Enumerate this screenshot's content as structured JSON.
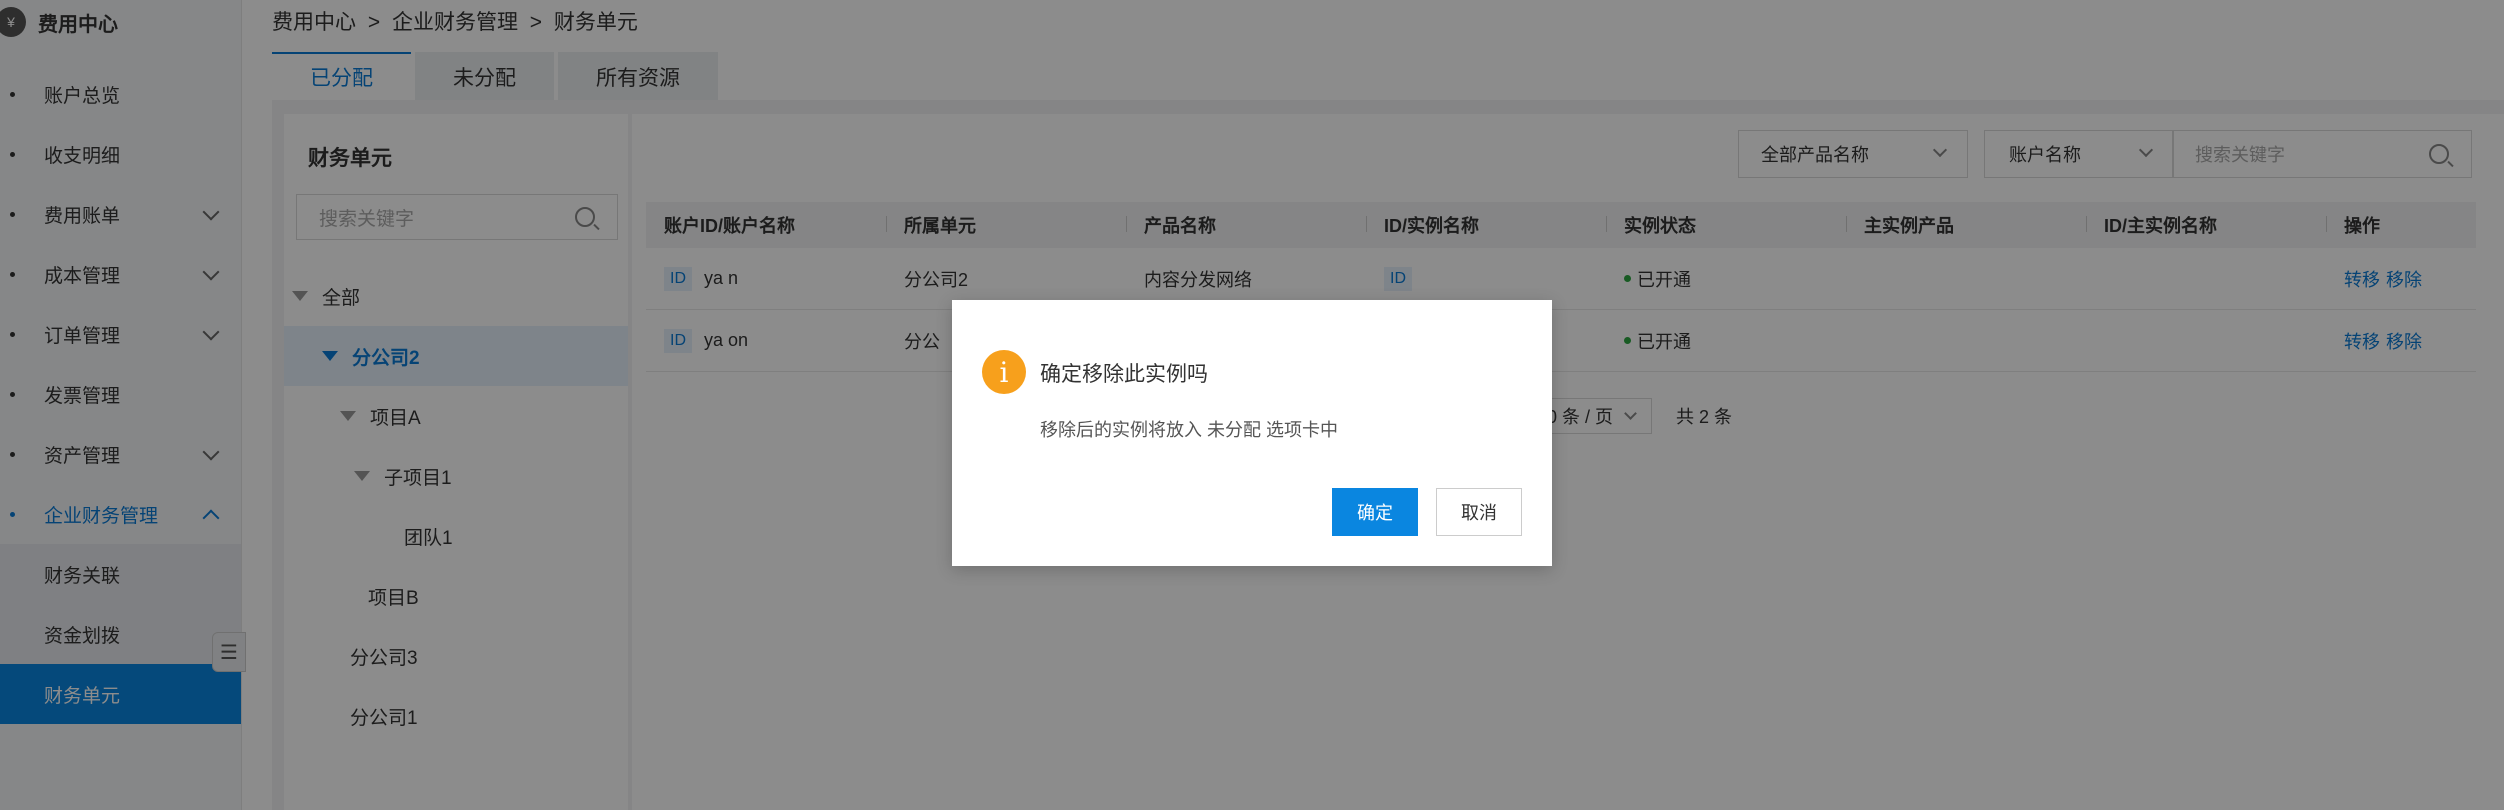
{
  "sidebar": {
    "title": "费用中心",
    "items": [
      {
        "label": "账户总览"
      },
      {
        "label": "收支明细"
      },
      {
        "label": "费用账单"
      },
      {
        "label": "成本管理"
      },
      {
        "label": "订单管理"
      },
      {
        "label": "发票管理"
      },
      {
        "label": "资产管理"
      },
      {
        "label": "企业财务管理"
      }
    ],
    "sub_items": [
      {
        "label": "财务关联"
      },
      {
        "label": "资金划拨"
      },
      {
        "label": "财务单元"
      }
    ]
  },
  "breadcrumb": {
    "a": "费用中心",
    "sep1": ">",
    "b": "企业财务管理",
    "sep2": ">",
    "c": "财务单元"
  },
  "tabs": [
    {
      "label": "已分配"
    },
    {
      "label": "未分配"
    },
    {
      "label": "所有资源"
    }
  ],
  "tree": {
    "title": "财务单元",
    "search_placeholder": "搜索关键字",
    "nodes": [
      "全部",
      "分公司2",
      "项目A",
      "子项目1",
      "团队1",
      "项目B",
      "分公司3",
      "分公司1"
    ]
  },
  "filters": {
    "product": "全部产品名称",
    "account": "账户名称",
    "search_placeholder": "搜索关键字"
  },
  "table": {
    "headers": [
      "账户ID/账户名称",
      "所属单元",
      "产品名称",
      "ID/实例名称",
      "实例状态",
      "主实例产品",
      "ID/主实例名称",
      "操作"
    ],
    "rows": [
      {
        "id_tag": "ID",
        "account": "ya   n",
        "unit": "分公司2",
        "product": "内容分发网络",
        "instance_tag": "ID",
        "status": "已开通",
        "op1": "转移",
        "op2": "移除"
      },
      {
        "id_tag": "ID",
        "account": "ya   on",
        "unit": "分公",
        "product": "",
        "instance_tag": "",
        "status": "已开通",
        "op1": "转移",
        "op2": "移除"
      }
    ]
  },
  "pager": {
    "page_size": "0 条 / 页",
    "total": "共 2 条"
  },
  "dialog": {
    "icon": "i",
    "title": "确定移除此实例吗",
    "message": "移除后的实例将放入 未分配 选项卡中",
    "confirm": "确定",
    "cancel": "取消"
  }
}
